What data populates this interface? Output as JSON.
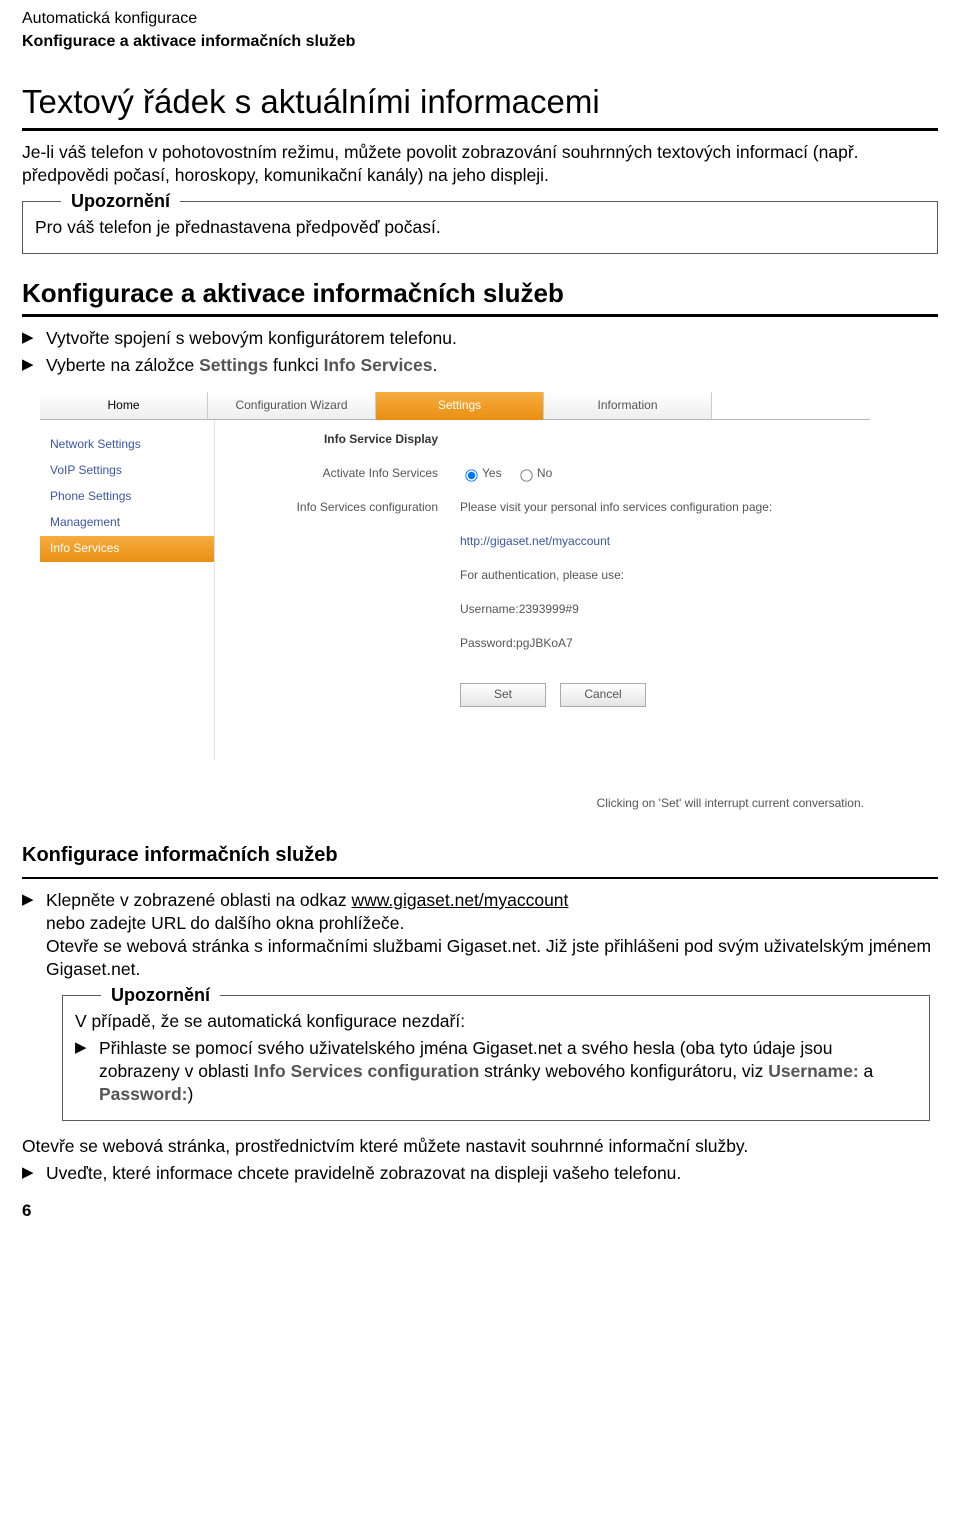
{
  "header": {
    "line1": "Automatická konfigurace",
    "line2": "Konfigurace a aktivace informačních služeb"
  },
  "section1": {
    "title": "Textový řádek s aktuálními informacemi",
    "p1": "Je-li váš telefon v pohotovostním režimu, můžete povolit zobrazování souhrnných textových informací (např. předpovědi počasí, horoskopy, komunikační kanály) na jeho displeji.",
    "notice_label": "Upozornění",
    "notice_text": "Pro váš telefon je přednastavena předpověď počasí."
  },
  "section2": {
    "title": "Konfigurace a aktivace informačních služeb",
    "step1": "Vytvořte spojení s webovým konfigurátorem telefonu.",
    "step2_pre": "Vyberte na záložce ",
    "step2_b1": "Settings",
    "step2_mid": " funkci ",
    "step2_b2": "Info Services",
    "step2_post": "."
  },
  "shot": {
    "tabs": [
      "Home",
      "Configuration Wizard",
      "Settings",
      "Information"
    ],
    "nav": [
      "Network Settings",
      "VoIP Settings",
      "Phone Settings",
      "Management",
      "Info Services"
    ],
    "labels": {
      "display": "Info Service Display",
      "activate": "Activate Info Services",
      "config": "Info Services configuration"
    },
    "radio_yes": "Yes",
    "radio_no": "No",
    "cfg_intro": "Please visit your personal info services configuration page:",
    "cfg_url": "http://gigaset.net/myaccount",
    "auth_intro": "For authentication, please use:",
    "username": "Username:2393999#9",
    "password": "Password:pgJBKoA7",
    "btn_set": "Set",
    "btn_cancel": "Cancel",
    "footnote": "Clicking on 'Set' will interrupt current conversation."
  },
  "section3": {
    "title": "Konfigurace informačních služeb",
    "bullet1_pre": "Klepněte v zobrazené oblasti na odkaz ",
    "bullet1_link": "www.gigaset.net/myaccount",
    "bullet1_line2": "nebo zadejte URL do dalšího okna prohlížeče.",
    "bullet1_line3": "Otevře se webová stránka s informačními službami Gigaset.net. Již jste přihlášeni pod svým uživatelským jménem Gigaset.net.",
    "notice_label": "Upozornění",
    "notice_line1": "V případě, že se automatická konfigurace nezdaří:",
    "notice_b_pre": "Přihlaste se pomocí svého uživatelského jména Gigaset.net a svého hesla (oba tyto údaje jsou zobrazeny v oblasti ",
    "notice_b_b1": "Info Services configuration",
    "notice_b_mid": " stránky webového konfigurátoru, viz ",
    "notice_b_b2": "Username:",
    "notice_b_mid2": " a ",
    "notice_b_b3": "Password:",
    "notice_b_post": ")",
    "after1": "Otevře se webová stránka, prostřednictvím které můžete nastavit souhrnné informační služby.",
    "after_bullet": "Uveďte, které informace chcete pravidelně zobrazovat na displeji vašeho telefonu."
  },
  "page_num": "6"
}
